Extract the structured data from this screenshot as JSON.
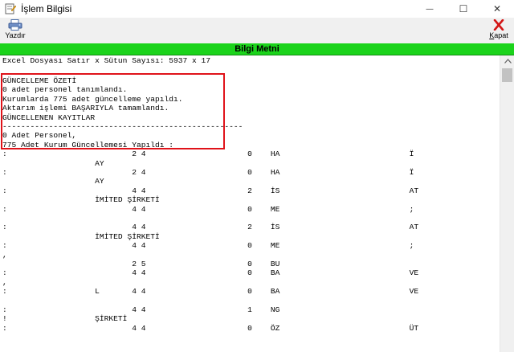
{
  "window": {
    "title": "İşlem Bilgisi",
    "minimize_glyph": "—",
    "maximize_glyph": "☐",
    "close_glyph": "✕"
  },
  "toolbar": {
    "print_label": "Yazdır",
    "close_label_prefix": "",
    "close_label_underlined": "K",
    "close_label_rest": "apat"
  },
  "header": {
    "title": "Bilgi Metni"
  },
  "content": {
    "summary_line": "Excel Dosyası Satır x Sütun Sayısı: 5937 x 17",
    "highlight": [
      "GÜNCELLEME ÖZETİ",
      "0 adet personel tanımlandı.",
      "Kurumlarda 775 adet güncelleme yapıldı.",
      "Aktarım işlemi BAŞARIYLA tamamlandı.",
      "GÜNCELLENEN KAYITLAR",
      "----------------------------------------------------",
      "0 Adet Personel,",
      "775 Adet Kurum Güncellemesi Yapıldı :"
    ],
    "rows": [
      ":                           2 4                      0    HA                            Ï",
      "                    AY",
      ":                           2 4                      0    HA                            Ï",
      "                    AY",
      ":                           4 4                      2    İS                            AT",
      "                    İMİTED ŞİRKETİ",
      ":                           4 4                      0    ME                            ;",
      "",
      ":                           4 4                      2    İS                            AT",
      "                    İMİTED ŞİRKETİ",
      ":                           4 4                      0    ME                            ;",
      ",",
      "                            2 5                      0    BU",
      ":                           4 4                      0    BA                            VE",
      ",",
      ":                   L       4 4                      0    BA                            VE",
      "",
      ":                           4 4                      1    NG",
      "!                   ŞİRKETİ",
      ":                           4 4                      0    ÖZ                            ÜT"
    ]
  },
  "colors": {
    "header_band": "#1bd31b",
    "highlight_border": "#e0131a"
  }
}
